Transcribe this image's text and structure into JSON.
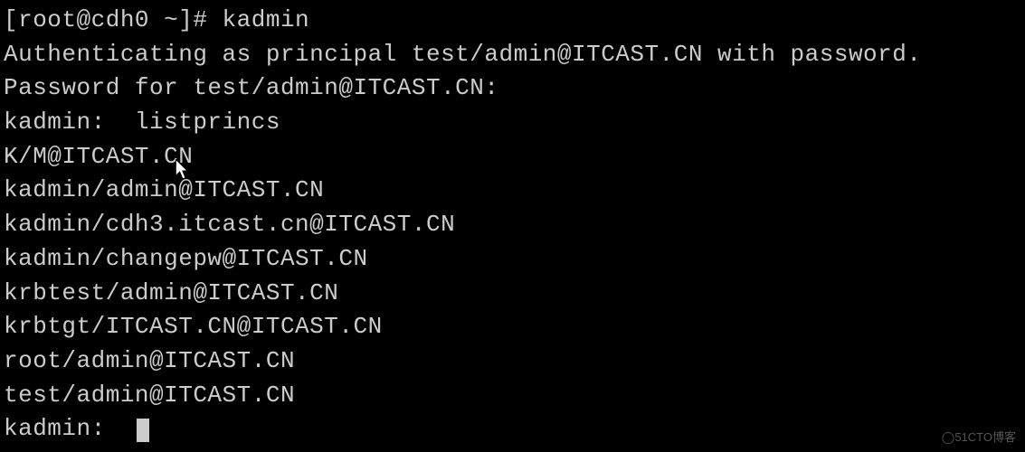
{
  "terminal": {
    "prompt_line": "[root@cdh0 ~]# kadmin",
    "auth_line": "Authenticating as principal test/admin@ITCAST.CN with password.",
    "password_line": "Password for test/admin@ITCAST.CN:",
    "cmd_line": "kadmin:  listprincs",
    "principals": [
      "K/M@ITCAST.CN",
      "kadmin/admin@ITCAST.CN",
      "kadmin/cdh3.itcast.cn@ITCAST.CN",
      "kadmin/changepw@ITCAST.CN",
      "krbtest/admin@ITCAST.CN",
      "krbtgt/ITCAST.CN@ITCAST.CN",
      "root/admin@ITCAST.CN",
      "test/admin@ITCAST.CN"
    ],
    "final_prompt": "kadmin:  "
  },
  "watermark": "51CTO博客"
}
